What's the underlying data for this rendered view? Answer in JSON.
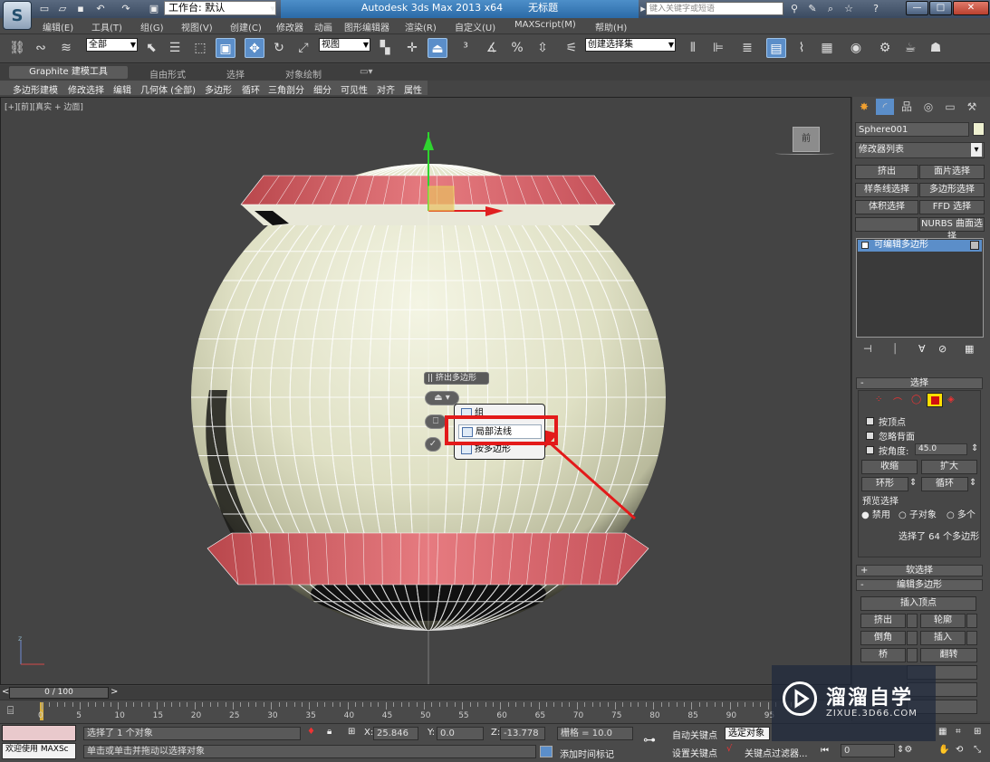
{
  "titlebar": {
    "workspace": "工作台: 默认",
    "app_name": "Autodesk 3ds Max  2013 x64",
    "doc_title": "无标题",
    "search_placeholder": "键入关键字或短语"
  },
  "menubar": [
    "编辑(E)",
    "工具(T)",
    "组(G)",
    "视图(V)",
    "创建(C)",
    "修改器",
    "动画",
    "图形编辑器",
    "渲染(R)",
    "自定义(U)",
    "MAXScript(M)",
    "帮助(H)"
  ],
  "toolbar": {
    "filter_select": "全部",
    "refcoord_select": "视图",
    "named_selection": "创建选择集"
  },
  "ribbon": {
    "tabs": [
      "Graphite 建模工具",
      "自由形式",
      "选择",
      "对象绘制"
    ],
    "panels": [
      "多边形建模",
      "修改选择",
      "编辑",
      "几何体 (全部)",
      "多边形",
      "循环",
      "三角剖分",
      "细分",
      "可见性",
      "对齐",
      "属性"
    ]
  },
  "viewport": {
    "label": "[+][前][真实 + 边面]",
    "viewcube_label": "前",
    "caddy_title": "挤出多边形",
    "dropdown_items": [
      "组",
      "局部法线",
      "按多边形"
    ]
  },
  "command_panel": {
    "object_name": "Sphere001",
    "modifier_list": "修改器列表",
    "quick_buttons": [
      "挤出",
      "面片选择",
      "样条线选择",
      "多边形选择",
      "体积选择",
      "FFD 选择",
      "",
      "NURBS 曲面选择"
    ],
    "stack_item": "可编辑多边形",
    "selection_rollout": "选择",
    "by_vertex": "按顶点",
    "ignore_backface": "忽略背面",
    "by_angle": "按角度:",
    "angle_value": "45.0",
    "shrink": "收缩",
    "grow": "扩大",
    "ring": "环形",
    "loop": "循环",
    "preview_label": "预览选择",
    "preview_options": [
      "禁用",
      "子对象",
      "多个"
    ],
    "selected_info": "选择了 64 个多边形",
    "soft_sel": "软选择",
    "edit_poly": "编辑多边形",
    "insert_vertex": "插入顶点",
    "extrude": "挤出",
    "outline": "轮廓",
    "bevel": "倒角",
    "inset": "插入",
    "bridge": "桥",
    "flip": "翻转"
  },
  "timeline": {
    "frame": "0 / 100",
    "ticks": [
      "0",
      "5",
      "10",
      "15",
      "20",
      "25",
      "30",
      "35",
      "40",
      "45",
      "50",
      "55",
      "60",
      "65",
      "70",
      "75",
      "80",
      "85",
      "90",
      "95"
    ]
  },
  "status": {
    "welcome": "欢迎使用 MAXSc",
    "selected": "选择了 1 个对象",
    "prompt": "单击或单击并拖动以选择对象",
    "x_label": "X:",
    "x_value": "25.846",
    "y_label": "Y:",
    "y_value": "0.0",
    "z_label": "Z:",
    "z_value": "-13.778",
    "grid": "栅格 = 10.0",
    "autokey": "自动关键点",
    "selected_obj": "选定对象",
    "setkey": "设置关键点",
    "keyfilter": "关键点过滤器...",
    "add_time_tag": "添加时间标记",
    "frame_value": "0"
  },
  "watermark": {
    "name": "溜溜自学",
    "url": "ZIXUE.3D66.COM"
  }
}
